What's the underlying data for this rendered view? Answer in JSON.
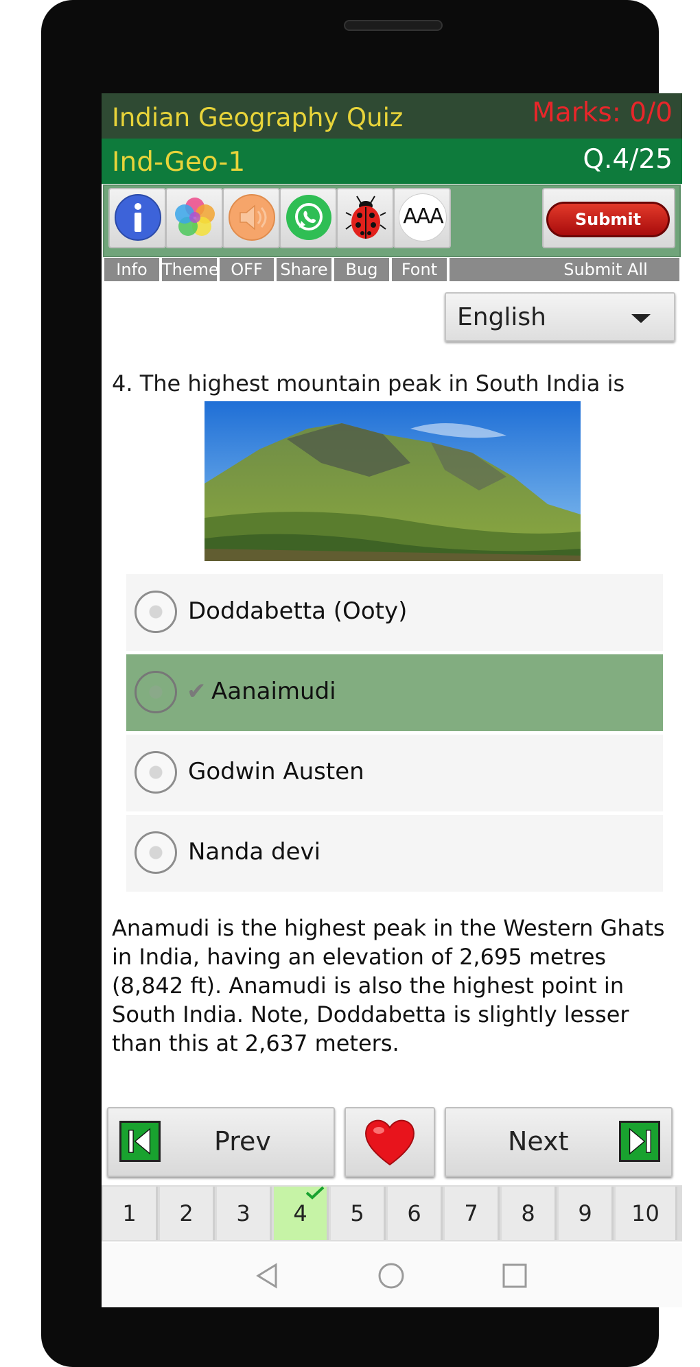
{
  "header": {
    "title": "Indian Geography Quiz",
    "marks": "Marks: 0/0",
    "quiz_id": "Ind-Geo-1",
    "question_counter": "Q.4/25"
  },
  "toolbar": {
    "info_label": "Info",
    "theme_label": "Theme",
    "sound_label": "OFF",
    "share_label": "Share",
    "bug_label": "Bug",
    "font_label": "Font",
    "font_icon_text": "AAA",
    "submit_button": "Submit",
    "submit_all_label": "Submit All"
  },
  "language": {
    "selected": "English"
  },
  "question": {
    "text": "4. The highest mountain peak in South India is",
    "options": [
      {
        "label": "Doddabetta (Ooty)",
        "selected": false
      },
      {
        "label": "Aanaimudi",
        "selected": true,
        "mark": "✔"
      },
      {
        "label": "Godwin Austen",
        "selected": false
      },
      {
        "label": "Nanda devi",
        "selected": false
      }
    ],
    "explanation": "Anamudi is the highest peak in the Western Ghats in India, having an elevation of 2,695 metres (8,842 ft). Anamudi is also the highest point in South India. Note, Doddabetta is slightly lesser than this at 2,637 meters."
  },
  "navigation": {
    "prev_label": "Prev",
    "next_label": "Next",
    "pages": [
      "1",
      "2",
      "3",
      "4",
      "5",
      "6",
      "7",
      "8",
      "9",
      "10"
    ],
    "current_page": "4"
  },
  "colors": {
    "title_bar": "#2f4a33",
    "sub_bar": "#0e7b3c",
    "title_text": "#e8d43a",
    "marks_text": "#e8262a",
    "selected_option": "#82ad80",
    "current_page": "#c6f3a6"
  }
}
